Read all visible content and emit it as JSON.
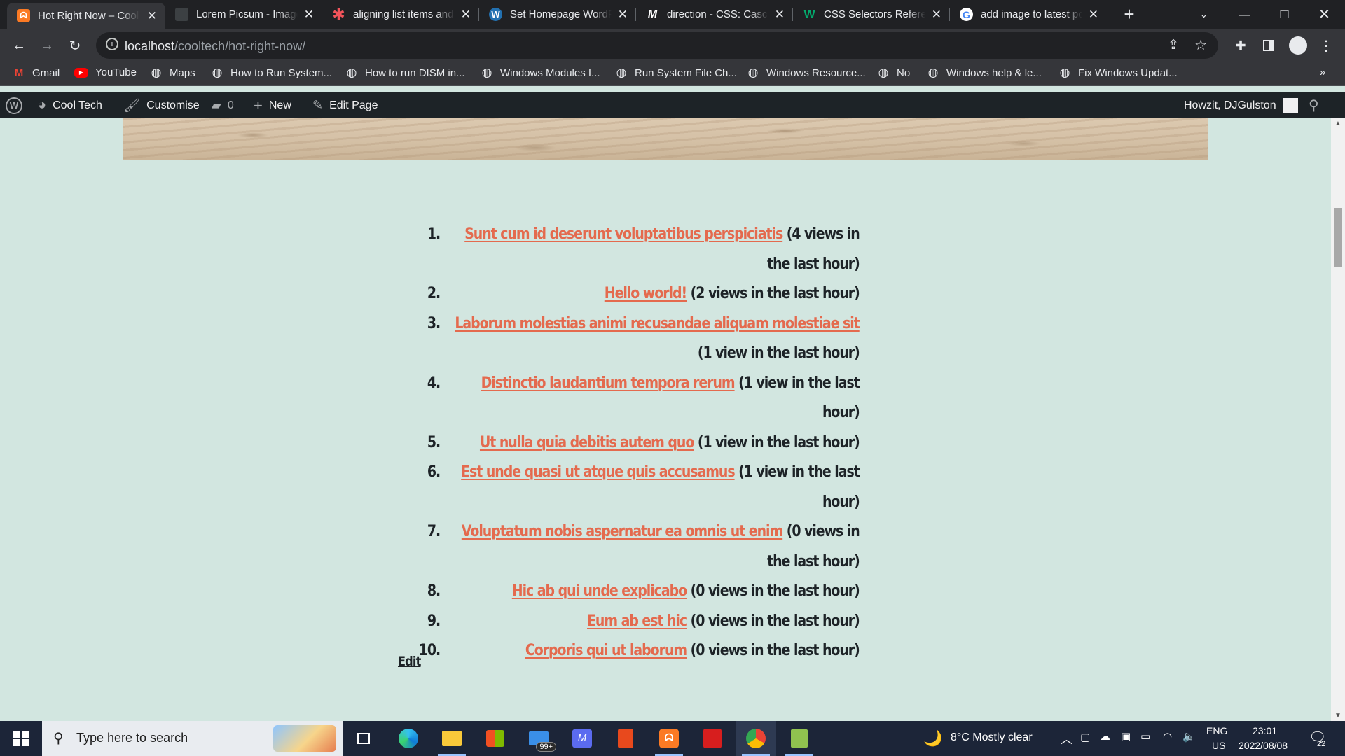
{
  "browser": {
    "tabs": [
      {
        "title": "Hot Right Now – Cool Tech",
        "favicon": "xampp-icon",
        "active": true
      },
      {
        "title": "Lorem Picsum - Images",
        "favicon": "picsum-icon",
        "active": false
      },
      {
        "title": "aligning list items and",
        "favicon": "asterisk-icon",
        "active": false
      },
      {
        "title": "Set Homepage WordPress",
        "favicon": "wordpress-icon",
        "active": false
      },
      {
        "title": "direction - CSS: Cascading",
        "favicon": "mdn-icon",
        "active": false
      },
      {
        "title": "CSS Selectors Reference",
        "favicon": "w3schools-icon",
        "active": false
      },
      {
        "title": "add image to latest post",
        "favicon": "google-icon",
        "active": false
      }
    ],
    "url_host": "localhost",
    "url_path": "/cooltech/hot-right-now/",
    "bookmarks": [
      "Gmail",
      "YouTube",
      "Maps",
      "How to Run System...",
      "How to run DISM in...",
      "Windows Modules I...",
      "Run System File Ch...",
      "Windows Resource...",
      "No",
      "Windows help & le...",
      "Fix Windows Updat..."
    ]
  },
  "adminbar": {
    "site_name": "Cool Tech",
    "customise": "Customise",
    "comments": "0",
    "new": "New",
    "edit_page": "Edit Page",
    "greeting": "Howzit, DJGulston"
  },
  "hot_list": [
    {
      "num": "1.",
      "title": "Sunt cum id deserunt voluptatibus perspiciatis",
      "views": "(4 views in the last hour)"
    },
    {
      "num": "2.",
      "title": "Hello world!",
      "views": "(2 views in the last hour)"
    },
    {
      "num": "3.",
      "title": "Laborum molestias animi recusandae aliquam molestiae sit",
      "views": "(1 view in the last hour)"
    },
    {
      "num": "4.",
      "title": "Distinctio laudantium tempora rerum",
      "views": "(1 view in the last hour)"
    },
    {
      "num": "5.",
      "title": "Ut nulla quia debitis autem quo",
      "views": "(1 view in the last hour)"
    },
    {
      "num": "6.",
      "title": "Est unde quasi ut atque quis accusamus",
      "views": "(1 view in the last hour)"
    },
    {
      "num": "7.",
      "title": "Voluptatum nobis aspernatur ea omnis ut enim",
      "views": "(0 views in the last hour)"
    },
    {
      "num": "8.",
      "title": "Hic ab qui unde explicabo",
      "views": "(0 views in the last hour)"
    },
    {
      "num": "9.",
      "title": "Eum ab est hic",
      "views": "(0 views in the last hour)"
    },
    {
      "num": "10.",
      "title": "Corporis qui ut laborum",
      "views": "(0 views in the last hour)"
    }
  ],
  "edit_label": "Edit",
  "taskbar": {
    "search_placeholder": "Type here to search",
    "mail_badge": "99+",
    "weather": "8°C  Mostly clear",
    "lang_top": "ENG",
    "lang_bottom": "US",
    "time": "23:01",
    "date": "2022/08/08",
    "notifications": "22"
  },
  "colors": {
    "link": "#e46a4e",
    "page_bg": "#d2e6e0",
    "adminbar_bg": "#1d2327",
    "chrome_dark": "#202124",
    "chrome_toolbar": "#35363a",
    "taskbar_bg": "#1c2538"
  }
}
